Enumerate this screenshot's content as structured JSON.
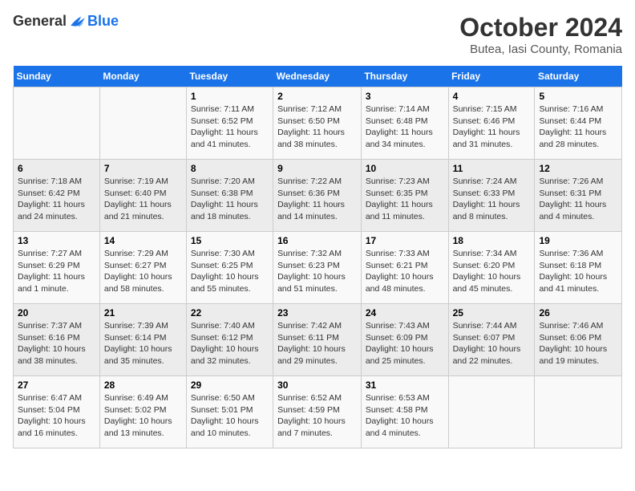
{
  "header": {
    "logo_general": "General",
    "logo_blue": "Blue",
    "month_title": "October 2024",
    "subtitle": "Butea, Iasi County, Romania"
  },
  "weekdays": [
    "Sunday",
    "Monday",
    "Tuesday",
    "Wednesday",
    "Thursday",
    "Friday",
    "Saturday"
  ],
  "weeks": [
    [
      {
        "day": "",
        "info": ""
      },
      {
        "day": "",
        "info": ""
      },
      {
        "day": "1",
        "info": "Sunrise: 7:11 AM\nSunset: 6:52 PM\nDaylight: 11 hours and 41 minutes."
      },
      {
        "day": "2",
        "info": "Sunrise: 7:12 AM\nSunset: 6:50 PM\nDaylight: 11 hours and 38 minutes."
      },
      {
        "day": "3",
        "info": "Sunrise: 7:14 AM\nSunset: 6:48 PM\nDaylight: 11 hours and 34 minutes."
      },
      {
        "day": "4",
        "info": "Sunrise: 7:15 AM\nSunset: 6:46 PM\nDaylight: 11 hours and 31 minutes."
      },
      {
        "day": "5",
        "info": "Sunrise: 7:16 AM\nSunset: 6:44 PM\nDaylight: 11 hours and 28 minutes."
      }
    ],
    [
      {
        "day": "6",
        "info": "Sunrise: 7:18 AM\nSunset: 6:42 PM\nDaylight: 11 hours and 24 minutes."
      },
      {
        "day": "7",
        "info": "Sunrise: 7:19 AM\nSunset: 6:40 PM\nDaylight: 11 hours and 21 minutes."
      },
      {
        "day": "8",
        "info": "Sunrise: 7:20 AM\nSunset: 6:38 PM\nDaylight: 11 hours and 18 minutes."
      },
      {
        "day": "9",
        "info": "Sunrise: 7:22 AM\nSunset: 6:36 PM\nDaylight: 11 hours and 14 minutes."
      },
      {
        "day": "10",
        "info": "Sunrise: 7:23 AM\nSunset: 6:35 PM\nDaylight: 11 hours and 11 minutes."
      },
      {
        "day": "11",
        "info": "Sunrise: 7:24 AM\nSunset: 6:33 PM\nDaylight: 11 hours and 8 minutes."
      },
      {
        "day": "12",
        "info": "Sunrise: 7:26 AM\nSunset: 6:31 PM\nDaylight: 11 hours and 4 minutes."
      }
    ],
    [
      {
        "day": "13",
        "info": "Sunrise: 7:27 AM\nSunset: 6:29 PM\nDaylight: 11 hours and 1 minute."
      },
      {
        "day": "14",
        "info": "Sunrise: 7:29 AM\nSunset: 6:27 PM\nDaylight: 10 hours and 58 minutes."
      },
      {
        "day": "15",
        "info": "Sunrise: 7:30 AM\nSunset: 6:25 PM\nDaylight: 10 hours and 55 minutes."
      },
      {
        "day": "16",
        "info": "Sunrise: 7:32 AM\nSunset: 6:23 PM\nDaylight: 10 hours and 51 minutes."
      },
      {
        "day": "17",
        "info": "Sunrise: 7:33 AM\nSunset: 6:21 PM\nDaylight: 10 hours and 48 minutes."
      },
      {
        "day": "18",
        "info": "Sunrise: 7:34 AM\nSunset: 6:20 PM\nDaylight: 10 hours and 45 minutes."
      },
      {
        "day": "19",
        "info": "Sunrise: 7:36 AM\nSunset: 6:18 PM\nDaylight: 10 hours and 41 minutes."
      }
    ],
    [
      {
        "day": "20",
        "info": "Sunrise: 7:37 AM\nSunset: 6:16 PM\nDaylight: 10 hours and 38 minutes."
      },
      {
        "day": "21",
        "info": "Sunrise: 7:39 AM\nSunset: 6:14 PM\nDaylight: 10 hours and 35 minutes."
      },
      {
        "day": "22",
        "info": "Sunrise: 7:40 AM\nSunset: 6:12 PM\nDaylight: 10 hours and 32 minutes."
      },
      {
        "day": "23",
        "info": "Sunrise: 7:42 AM\nSunset: 6:11 PM\nDaylight: 10 hours and 29 minutes."
      },
      {
        "day": "24",
        "info": "Sunrise: 7:43 AM\nSunset: 6:09 PM\nDaylight: 10 hours and 25 minutes."
      },
      {
        "day": "25",
        "info": "Sunrise: 7:44 AM\nSunset: 6:07 PM\nDaylight: 10 hours and 22 minutes."
      },
      {
        "day": "26",
        "info": "Sunrise: 7:46 AM\nSunset: 6:06 PM\nDaylight: 10 hours and 19 minutes."
      }
    ],
    [
      {
        "day": "27",
        "info": "Sunrise: 6:47 AM\nSunset: 5:04 PM\nDaylight: 10 hours and 16 minutes."
      },
      {
        "day": "28",
        "info": "Sunrise: 6:49 AM\nSunset: 5:02 PM\nDaylight: 10 hours and 13 minutes."
      },
      {
        "day": "29",
        "info": "Sunrise: 6:50 AM\nSunset: 5:01 PM\nDaylight: 10 hours and 10 minutes."
      },
      {
        "day": "30",
        "info": "Sunrise: 6:52 AM\nSunset: 4:59 PM\nDaylight: 10 hours and 7 minutes."
      },
      {
        "day": "31",
        "info": "Sunrise: 6:53 AM\nSunset: 4:58 PM\nDaylight: 10 hours and 4 minutes."
      },
      {
        "day": "",
        "info": ""
      },
      {
        "day": "",
        "info": ""
      }
    ]
  ]
}
